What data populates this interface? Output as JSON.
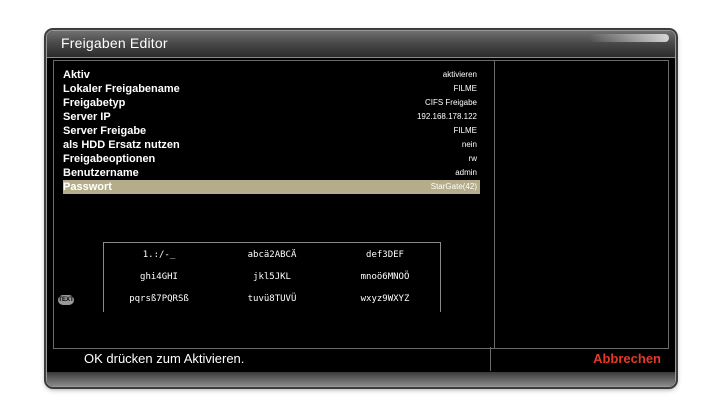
{
  "window": {
    "title": "Freigaben Editor"
  },
  "settings": [
    {
      "label": "Aktiv",
      "value": "aktivieren",
      "selected": false
    },
    {
      "label": "Lokaler Freigabename",
      "value": "FILME",
      "selected": false
    },
    {
      "label": "Freigabetyp",
      "value": "CIFS Freigabe",
      "selected": false
    },
    {
      "label": "Server IP",
      "value": "192.168.178.122",
      "selected": false
    },
    {
      "label": "Server Freigabe",
      "value": "FILME",
      "selected": false
    },
    {
      "label": "als HDD Ersatz nutzen",
      "value": "nein",
      "selected": false
    },
    {
      "label": "Freigabeoptionen",
      "value": "rw",
      "selected": false
    },
    {
      "label": "Benutzername",
      "value": "admin",
      "selected": false
    },
    {
      "label": "Passwort",
      "value": "StarGate(42)",
      "selected": true
    }
  ],
  "keypad": {
    "keys": [
      [
        "1.:/-_",
        "abcä2ABCÄ",
        "def3DEF"
      ],
      [
        "ghi4GHI",
        "jkl5JKL",
        "mnoö6MNOÖ"
      ],
      [
        "pqrsß7PQRSß",
        "tuvü8TUVÜ",
        "wxyz9WXYZ"
      ]
    ],
    "text_badge": "TEXT"
  },
  "footer": {
    "hint": "OK drücken zum Aktivieren.",
    "cancel": "Abbrechen"
  },
  "colors": {
    "selected_row": "#b5ad8a",
    "cancel": "#e23a2a"
  }
}
